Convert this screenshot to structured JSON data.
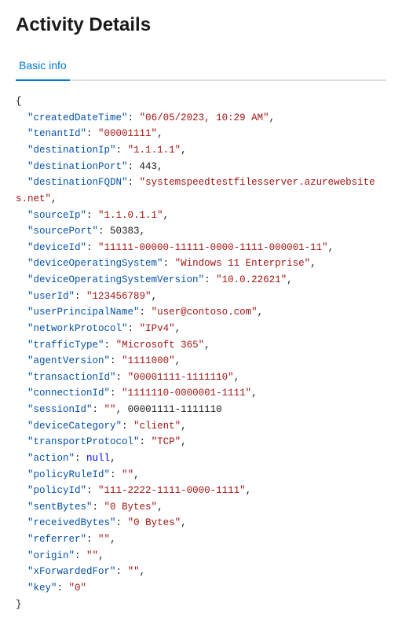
{
  "header": {
    "title": "Activity Details"
  },
  "tabs": [
    {
      "label": "Basic info",
      "active": true
    }
  ],
  "json_data": {
    "createdDateTime": "06/05/2023, 10:29 AM",
    "tenantId": "00001111",
    "destinationIp": "1.1.1.1",
    "destinationPort": "443",
    "destinationFQDN": "systemspeedtestfilesserver.azurewebsites.net",
    "sourceIp": "1.1.0.1.1",
    "sourcePort": "50383",
    "deviceId": "11111-00000-11111-0000-1111-000001-11",
    "deviceOperatingSystem": "Windows 11 Enterprise",
    "deviceOperatingSystemVersion": "10.0.22621",
    "userId": "123456789",
    "userPrincipalName": "user@contoso.com",
    "networkProtocol": "IPv4",
    "trafficType": "Microsoft 365",
    "agentVersion": "1111000",
    "transactionId": "00001111-1111110",
    "connectionId": "1111110-0000001-1111",
    "sessionId": "00001111-1111110",
    "deviceCategory": "client",
    "transportProtocol": "TCP",
    "action": "null",
    "policyRuleId": "",
    "policyId": "111-2222-1111-0000-1111",
    "sentBytes": "0 Bytes",
    "receivedBytes": "0 Bytes",
    "referrer": "",
    "origin": "",
    "xForwardedFor": "",
    "key": "0"
  }
}
